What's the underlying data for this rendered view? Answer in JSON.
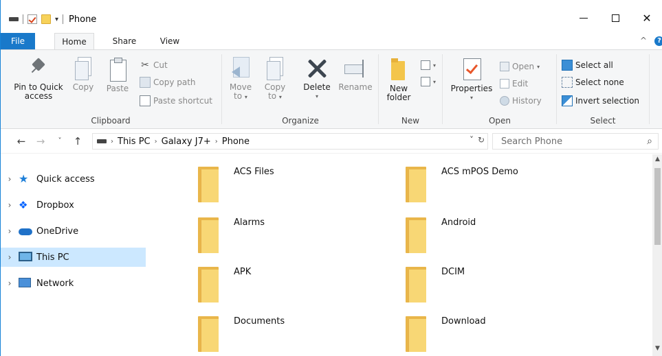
{
  "window": {
    "title": "Phone"
  },
  "tabs": [
    {
      "label": "File"
    },
    {
      "label": "Home"
    },
    {
      "label": "Share"
    },
    {
      "label": "View"
    }
  ],
  "ribbon": {
    "clipboard": {
      "label": "Clipboard",
      "pin": "Pin to Quick",
      "pin2": "access",
      "copy": "Copy",
      "paste": "Paste",
      "cut": "Cut",
      "copy_path": "Copy path",
      "paste_shortcut": "Paste shortcut"
    },
    "organize": {
      "label": "Organize",
      "move": "Move",
      "move_to": "to",
      "copy": "Copy",
      "copy_to": "to",
      "delete": "Delete",
      "rename": "Rename"
    },
    "new": {
      "label": "New",
      "new": "New",
      "folder": "folder"
    },
    "open": {
      "label": "Open",
      "properties": "Properties",
      "open": "Open",
      "edit": "Edit",
      "history": "History"
    },
    "select": {
      "label": "Select",
      "select_all": "Select all",
      "select_none": "Select none",
      "invert": "Invert selection"
    }
  },
  "address": {
    "crumbs": [
      "This PC",
      "Galaxy J7+",
      "Phone"
    ]
  },
  "search": {
    "placeholder": "Search Phone"
  },
  "nav": [
    {
      "label": "Quick access",
      "icon": "star-icon"
    },
    {
      "label": "Dropbox",
      "icon": "dropbox-icon"
    },
    {
      "label": "OneDrive",
      "icon": "cloud-icon"
    },
    {
      "label": "This PC",
      "icon": "computer-icon",
      "selected": true
    },
    {
      "label": "Network",
      "icon": "network-icon"
    }
  ],
  "folders": [
    {
      "name": "ACS Files"
    },
    {
      "name": "ACS mPOS Demo"
    },
    {
      "name": "Alarms"
    },
    {
      "name": "Android"
    },
    {
      "name": "APK"
    },
    {
      "name": "DCIM"
    },
    {
      "name": "Documents"
    },
    {
      "name": "Download"
    }
  ],
  "colors": {
    "accent": "#1979ca",
    "selection": "#cce8ff",
    "folder": "#f8d775"
  }
}
